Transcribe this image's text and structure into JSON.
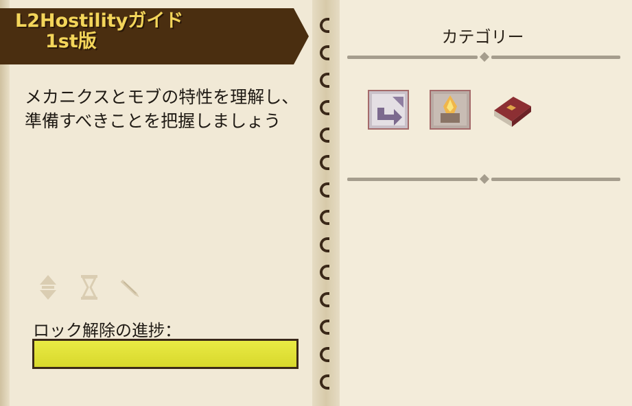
{
  "guide": {
    "title_line1": "L2Hostilityガイド",
    "title_line2": "1st版",
    "description": "メカニクスとモブの特性を理解し、準備すべきことを把握しましょう"
  },
  "tools": [
    {
      "icon": "sort-arrows-icon"
    },
    {
      "icon": "hourglass-icon"
    },
    {
      "icon": "quill-icon"
    }
  ],
  "progress": {
    "label": "ロック解除の進捗：",
    "value": 1.0,
    "fill_color": "#e2e33a"
  },
  "categories": {
    "title": "カテゴリー",
    "items": [
      {
        "icon": "return-arrow-icon"
      },
      {
        "icon": "flame-altar-icon"
      },
      {
        "icon": "red-book-icon"
      }
    ]
  },
  "colors": {
    "banner": "#4a2e10",
    "title_text": "#f3d55a",
    "page": "#f1e9d6"
  }
}
